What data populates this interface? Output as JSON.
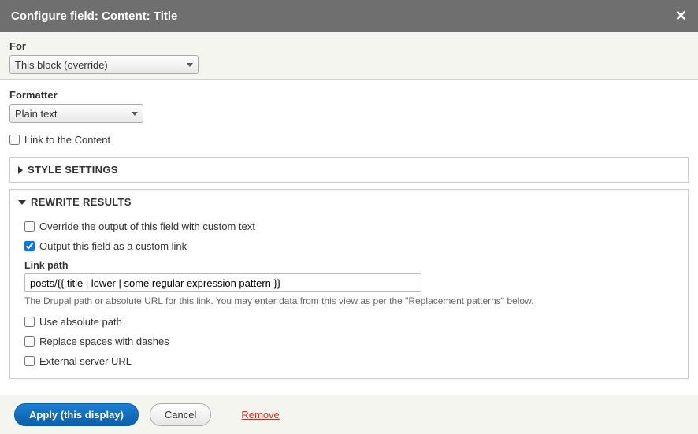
{
  "header": {
    "title": "Configure field: Content: Title"
  },
  "for": {
    "label": "For",
    "value": "This block (override)"
  },
  "formatter": {
    "label": "Formatter",
    "value": "Plain text"
  },
  "link_content": {
    "label": "Link to the Content",
    "checked": false
  },
  "style_settings": {
    "title": "STYLE SETTINGS"
  },
  "rewrite": {
    "title": "REWRITE RESULTS",
    "override": {
      "label": "Override the output of this field with custom text",
      "checked": false
    },
    "output_link": {
      "label": "Output this field as a custom link",
      "checked": true
    },
    "link_path": {
      "label": "Link path",
      "value": "posts/{{ title | lower | some regular expression pattern }}",
      "help": "The Drupal path or absolute URL for this link. You may enter data from this view as per the \"Replacement patterns\" below."
    },
    "absolute": {
      "label": "Use absolute path",
      "checked": false
    },
    "replace_spaces": {
      "label": "Replace spaces with dashes",
      "checked": false
    },
    "external": {
      "label": "External server URL",
      "checked": false
    }
  },
  "footer": {
    "apply": "Apply (this display)",
    "cancel": "Cancel",
    "remove": "Remove"
  }
}
